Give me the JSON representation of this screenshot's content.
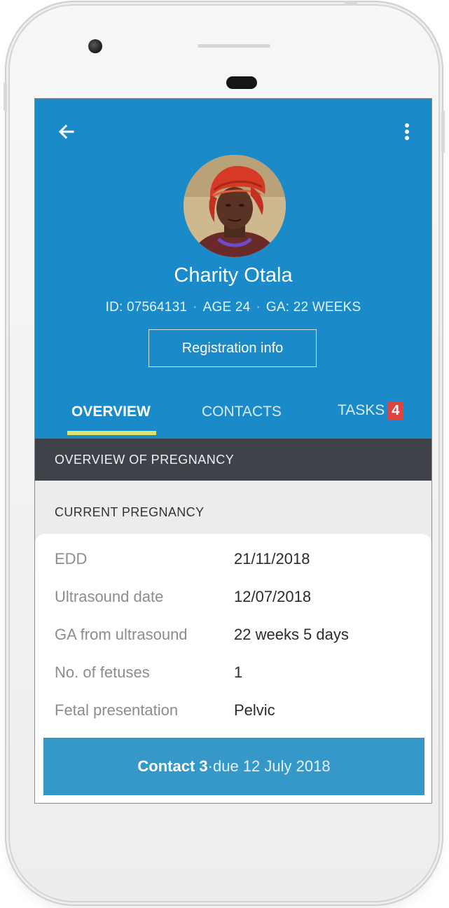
{
  "colors": {
    "header_bg": "#1a8ac8",
    "tab_indicator": "#d9e46a",
    "badge_bg": "#e14242",
    "section_bar_bg": "#3f4248",
    "contact_bar_bg": "#3598c9"
  },
  "header": {
    "back_icon": "arrow-left-icon",
    "menu_icon": "more-vert-icon",
    "avatar_icon": "avatar-photo",
    "name": "Charity Otala",
    "meta": {
      "id": "ID: 07564131",
      "separator": "·",
      "age": "AGE 24",
      "ga": "GA: 22 WEEKS"
    },
    "registration_button": "Registration info"
  },
  "tabs": [
    {
      "label": "OVERVIEW",
      "active": true
    },
    {
      "label": "CONTACTS",
      "active": false
    },
    {
      "label": "TASKS",
      "active": false,
      "badge": "4"
    }
  ],
  "section": {
    "title": "OVERVIEW OF PREGNANCY",
    "subtitle": "CURRENT PREGNANCY"
  },
  "details": [
    {
      "label": "EDD",
      "value": "21/11/2018"
    },
    {
      "label": "Ultrasound date",
      "value": "12/07/2018"
    },
    {
      "label": "GA from ultrasound",
      "value": "22 weeks 5 days"
    },
    {
      "label": "No. of fetuses",
      "value": "1"
    },
    {
      "label": "Fetal presentation",
      "value": "Pelvic"
    }
  ],
  "contact_bar": {
    "contact": "Contact 3",
    "separator": " · ",
    "due": "due 12 July 2018"
  }
}
